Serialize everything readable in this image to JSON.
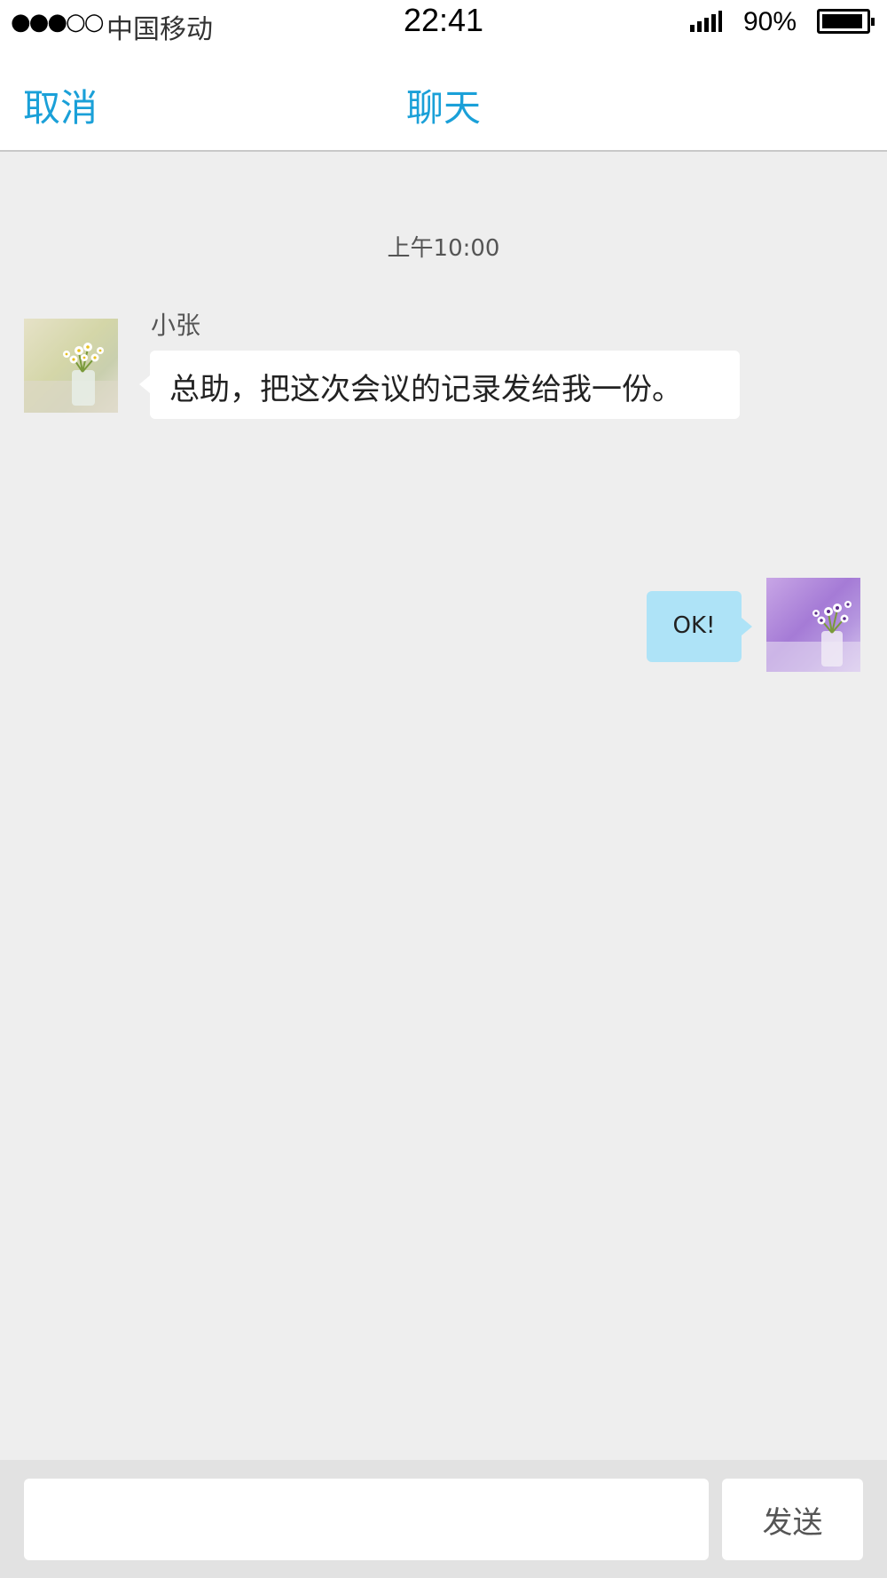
{
  "status_bar": {
    "signal_dots": "●●●○○",
    "carrier": "中国移动",
    "time": "22:41",
    "battery": "90%",
    "icons": [
      "signal-bars-icon",
      "battery-icon"
    ]
  },
  "nav": {
    "cancel_label": "取消",
    "title": "聊天",
    "accent_color": "#1aa0d8"
  },
  "chat": {
    "timestamp": "上午10:00",
    "messages": [
      {
        "sender": "小张",
        "text": "总助，把这次会议的记录发给我一份。",
        "side": "left",
        "bubble_color": "#ffffff"
      },
      {
        "sender": "",
        "text": "OK!",
        "side": "right",
        "bubble_color": "#aee3f7"
      }
    ]
  },
  "input_bar": {
    "message_placeholder": "",
    "send_label": "发送"
  }
}
